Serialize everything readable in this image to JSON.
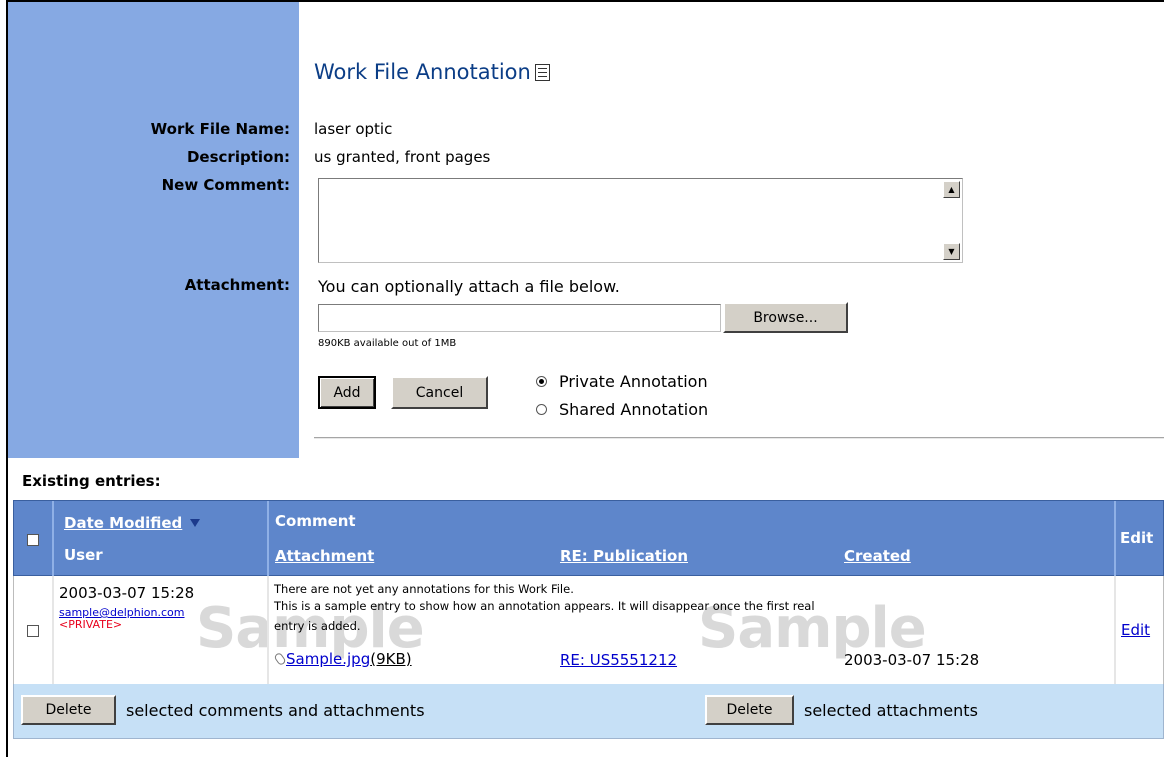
{
  "page": {
    "title": "Work File Annotation",
    "title_icon": "document-icon"
  },
  "form": {
    "work_file_name_label": "Work File Name:",
    "work_file_name_value": "laser optic",
    "description_label": "Description:",
    "description_value": "us granted, front pages",
    "new_comment_label": "New Comment:",
    "new_comment_value": "",
    "attachment_label": "Attachment:",
    "attachment_hint": "You can optionally attach a file below.",
    "attachment_file_value": "",
    "browse_label": "Browse...",
    "quota_text": "890KB available out of 1MB",
    "add_label": "Add",
    "cancel_label": "Cancel",
    "visibility_options": [
      {
        "label": "Private Annotation",
        "selected": true
      },
      {
        "label": "Shared Annotation",
        "selected": false
      }
    ]
  },
  "entries": {
    "heading": "Existing entries:",
    "columns": {
      "date_modified": "Date Modified",
      "user": "User",
      "comment": "Comment",
      "attachment": "Attachment",
      "re_publication": "RE: Publication",
      "created": "Created",
      "edit": "Edit"
    },
    "sort_icon": "sort-descending-icon",
    "rows": [
      {
        "date_modified": "2003-03-07 15:28",
        "user": "sample@delphion.com",
        "visibility": "<PRIVATE>",
        "comment_line1": "There are not yet any annotations for this Work File.",
        "comment_line2": "This is a sample entry to show how an annotation appears. It will disappear once the first real",
        "comment_line3": "entry is added.",
        "attachment_name": "Sample.jpg",
        "attachment_size": "(9KB)",
        "re_publication": "RE: US5551212",
        "created": "2003-03-07 15:28",
        "edit": "Edit",
        "watermark": "Sample",
        "selected": false
      }
    ],
    "footer": {
      "delete_label": "Delete",
      "delete_all_text": "selected comments and attachments",
      "delete_attachments_label": "Delete",
      "delete_attachments_text": "selected attachments"
    }
  },
  "colors": {
    "panel": "#86a9e3",
    "header": "#5e86cb",
    "footer": "#c6e0f6",
    "title": "#0b3d86",
    "private": "#e8001c",
    "link": "#0000cc"
  }
}
